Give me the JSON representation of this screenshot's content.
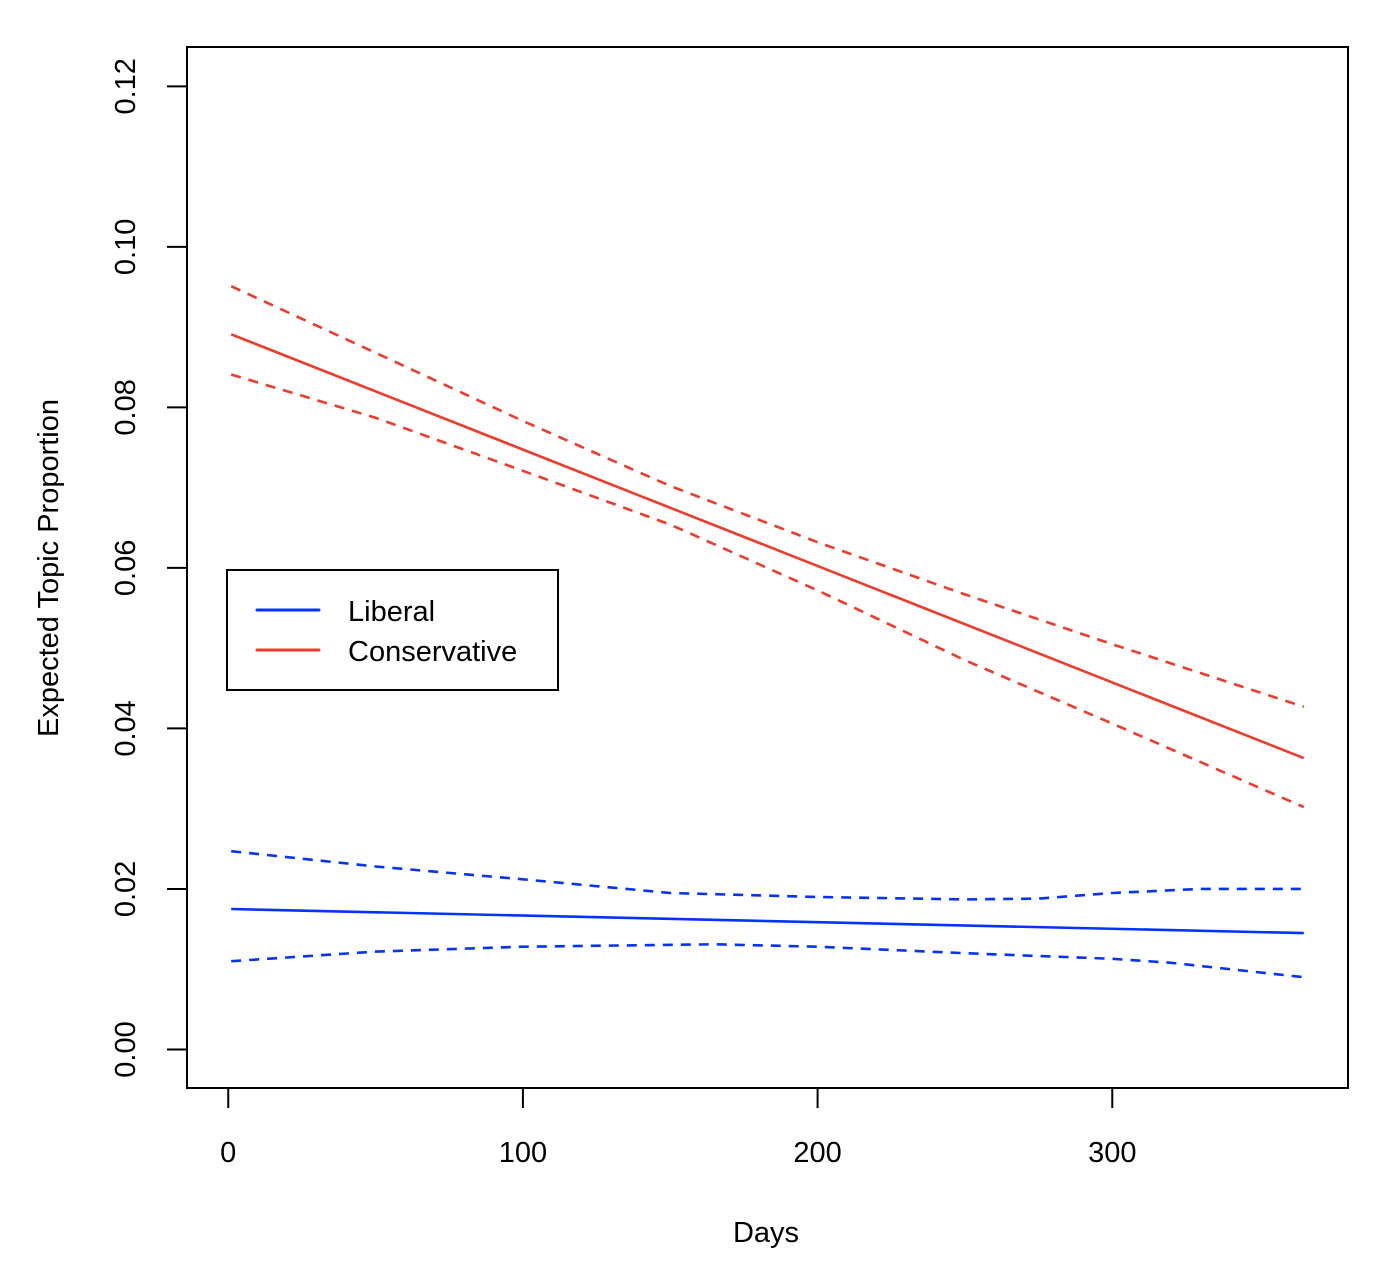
{
  "chart_data": {
    "type": "line",
    "title": "",
    "xlabel": "Days",
    "ylabel": "Expected Topic Proportion",
    "xlim": [
      -14,
      380
    ],
    "ylim": [
      -0.0048,
      0.1249
    ],
    "xticks": [
      0,
      100,
      200,
      300
    ],
    "xtick_labels": [
      "0",
      "100",
      "200",
      "300"
    ],
    "yticks": [
      0.0,
      0.02,
      0.04,
      0.06,
      0.08,
      0.1,
      0.12
    ],
    "ytick_labels": [
      "0.00",
      "0.02",
      "0.04",
      "0.06",
      "0.08",
      "0.10",
      "0.12"
    ],
    "grid": false,
    "legend": {
      "placement": "center-left",
      "entries": [
        {
          "label": "Liberal",
          "color": "#0433ff"
        },
        {
          "label": "Conservative",
          "color": "#ee3b2c"
        }
      ]
    },
    "series": [
      {
        "name": "Liberal",
        "color": "#0433ff",
        "style": "solid",
        "x": [
          1,
          365
        ],
        "values": [
          0.0175,
          0.0145
        ]
      },
      {
        "name": "Liberal upper bound",
        "color": "#0433ff",
        "style": "dashed",
        "x": [
          1,
          50,
          100,
          150,
          200,
          250,
          275,
          300,
          330,
          365
        ],
        "values": [
          0.0247,
          0.0228,
          0.0212,
          0.0195,
          0.019,
          0.0187,
          0.0188,
          0.0195,
          0.02,
          0.02
        ]
      },
      {
        "name": "Liberal lower bound",
        "color": "#0433ff",
        "style": "dashed",
        "x": [
          1,
          50,
          100,
          165,
          200,
          250,
          300,
          320,
          365
        ],
        "values": [
          0.011,
          0.0122,
          0.0128,
          0.0131,
          0.0128,
          0.012,
          0.0113,
          0.0108,
          0.009
        ]
      },
      {
        "name": "Conservative",
        "color": "#ee3b2c",
        "style": "solid",
        "x": [
          1,
          365
        ],
        "values": [
          0.0891,
          0.0363
        ]
      },
      {
        "name": "Conservative upper bound",
        "color": "#ee3b2c",
        "style": "dashed",
        "x": [
          1,
          50,
          100,
          150,
          200,
          250,
          300,
          365
        ],
        "values": [
          0.0951,
          0.0868,
          0.0783,
          0.0702,
          0.0632,
          0.0567,
          0.0505,
          0.0427
        ],
        "note": "slightly bowed upward"
      },
      {
        "name": "Conservative lower bound",
        "color": "#ee3b2c",
        "style": "dashed",
        "x": [
          1,
          50,
          100,
          150,
          200,
          250,
          300,
          365
        ],
        "values": [
          0.0841,
          0.0787,
          0.0721,
          0.0654,
          0.0572,
          0.0485,
          0.0406,
          0.0302
        ]
      }
    ]
  }
}
